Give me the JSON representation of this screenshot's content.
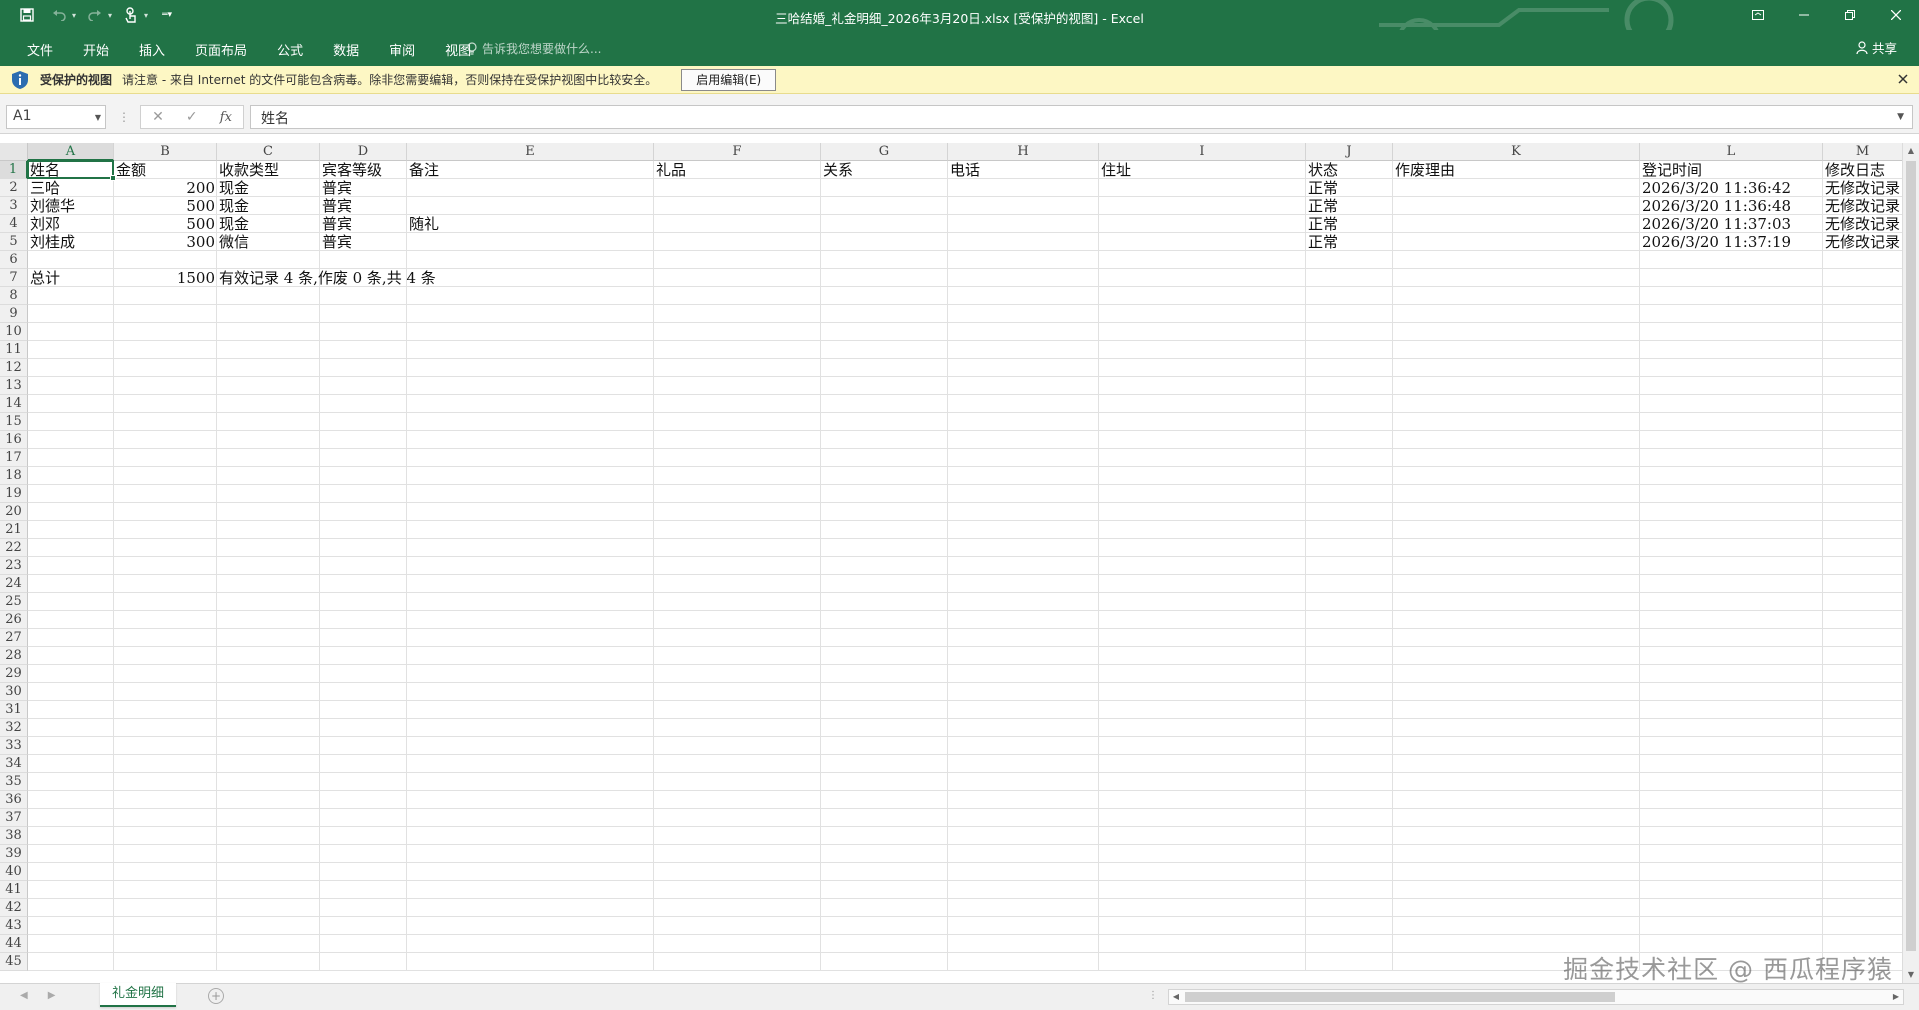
{
  "window": {
    "title": "三哈结婚_礼金明细_2026年3月20日.xlsx  [受保护的视图] - Excel"
  },
  "ribbon": {
    "tabs": [
      "文件",
      "开始",
      "插入",
      "页面布局",
      "公式",
      "数据",
      "审阅",
      "视图"
    ],
    "tell_me": "告诉我您想要做什么...",
    "share": "共享"
  },
  "protected_view": {
    "title": "受保护的视图",
    "message": "请注意 - 来自 Internet 的文件可能包含病毒。除非您需要编辑，否则保持在受保护视图中比较安全。",
    "button": "启用编辑(E)"
  },
  "formula_bar": {
    "name_box": "A1",
    "fx": "fx",
    "value": "姓名"
  },
  "sheet": {
    "columns": [
      "A",
      "B",
      "C",
      "D",
      "E",
      "F",
      "G",
      "H",
      "I",
      "J",
      "K",
      "L",
      "M"
    ],
    "active_column": "A",
    "active_row": 1,
    "row_count": 45,
    "rows": [
      [
        "姓名",
        "金额",
        "收款类型",
        "宾客等级",
        "备注",
        "礼品",
        "关系",
        "电话",
        "住址",
        "状态",
        "作废理由",
        "登记时间",
        "修改日志"
      ],
      [
        "三哈",
        "200",
        "现金",
        "普宾",
        "",
        "",
        "",
        "",
        "",
        "正常",
        "",
        "2026/3/20 11:36:42",
        "无修改记录"
      ],
      [
        "刘德华",
        "500",
        "现金",
        "普宾",
        "",
        "",
        "",
        "",
        "",
        "正常",
        "",
        "2026/3/20 11:36:48",
        "无修改记录"
      ],
      [
        "刘邓",
        "500",
        "现金",
        "普宾",
        "随礼",
        "",
        "",
        "",
        "",
        "正常",
        "",
        "2026/3/20 11:37:03",
        "无修改记录"
      ],
      [
        "刘桂成",
        "300",
        "微信",
        "普宾",
        "",
        "",
        "",
        "",
        "",
        "正常",
        "",
        "2026/3/20 11:37:19",
        "无修改记录"
      ],
      [
        "",
        "",
        "",
        "",
        "",
        "",
        "",
        "",
        "",
        "",
        "",
        "",
        ""
      ],
      [
        "总计",
        "1500",
        "有效记录 4 条,作废 0 条,共 4 条",
        "",
        "",
        "",
        "",
        "",
        "",
        "",
        "",
        "",
        ""
      ]
    ]
  },
  "sheet_tabs": {
    "active": "礼金明细"
  },
  "watermark": "掘金技术社区 @ 西瓜程序猿"
}
